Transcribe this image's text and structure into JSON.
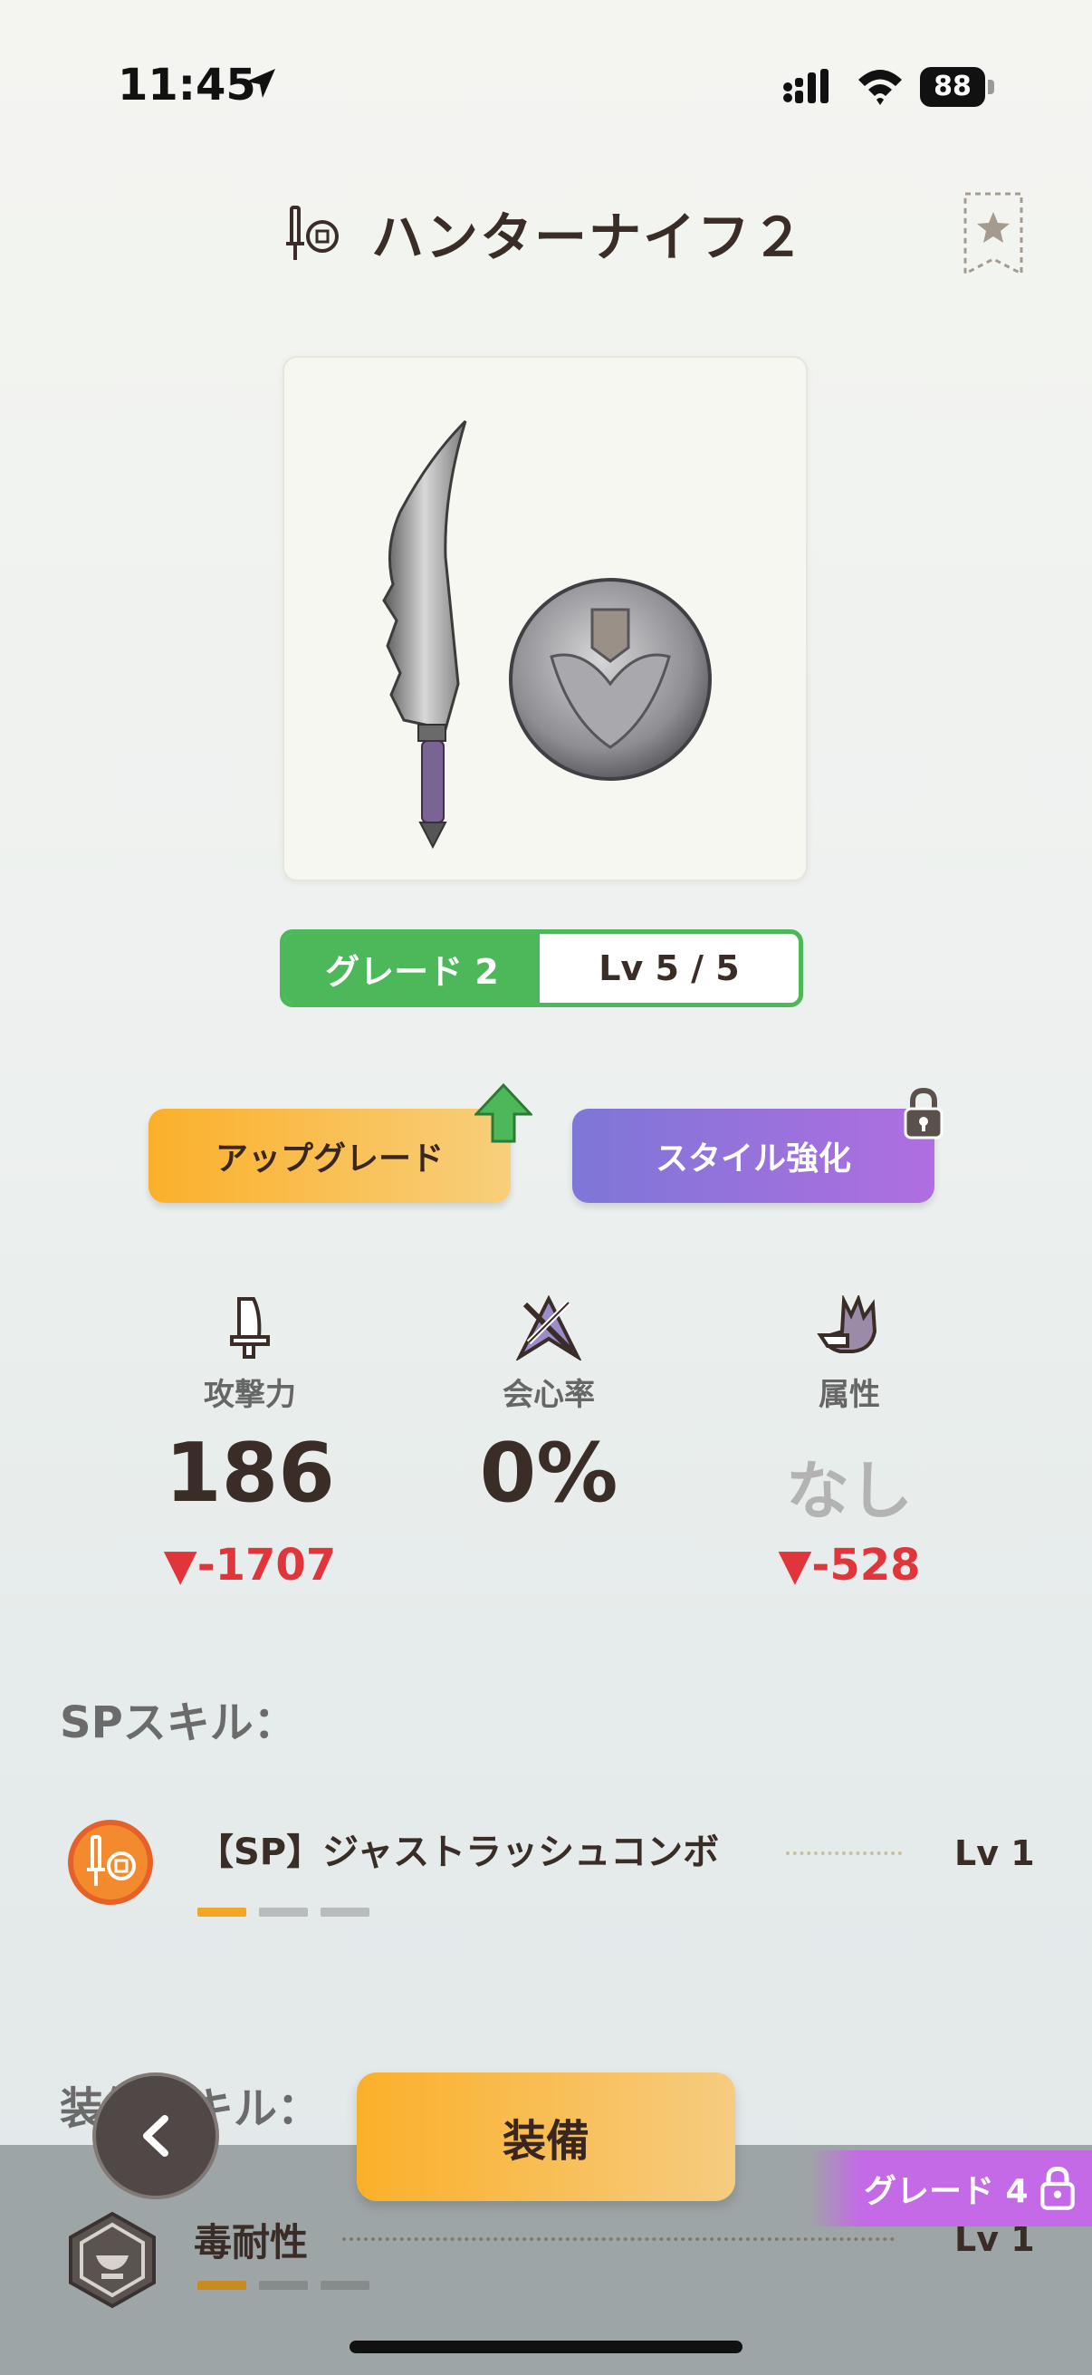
{
  "status_bar": {
    "time": "11:45",
    "battery": "88"
  },
  "header": {
    "title": "ハンターナイフ２"
  },
  "grade": {
    "grade_label": "グレード 2",
    "level_label": "Lv 5 / 5"
  },
  "actions": {
    "upgrade_label": "アップグレード",
    "style_label": "スタイル強化"
  },
  "stats": [
    {
      "label": "攻撃力",
      "value": "186",
      "diff": "▼-1707"
    },
    {
      "label": "会心率",
      "value": "0%",
      "diff": ""
    },
    {
      "label": "属性",
      "value": "なし",
      "diff": "▼-528"
    }
  ],
  "sp_skill": {
    "section_label": "SPスキル：",
    "name": "【SP】ジャストラッシュコンボ",
    "level": "Lv 1",
    "progress_filled": 1,
    "progress_total": 3
  },
  "equip_skill": {
    "section_label": "装備スキル：",
    "name": "毒耐性",
    "level": "Lv 1",
    "progress_filled": 1,
    "progress_total": 3
  },
  "bottom": {
    "equip_label": "装備",
    "grade_tag": "グレード 4"
  },
  "colors": {
    "grade_green": "#4cb85a",
    "upgrade_orange": "#fbb02a",
    "style_purple": "#9a70dc",
    "diff_red": "#e0353b",
    "grade_tag_purple": "#c46ae6"
  }
}
